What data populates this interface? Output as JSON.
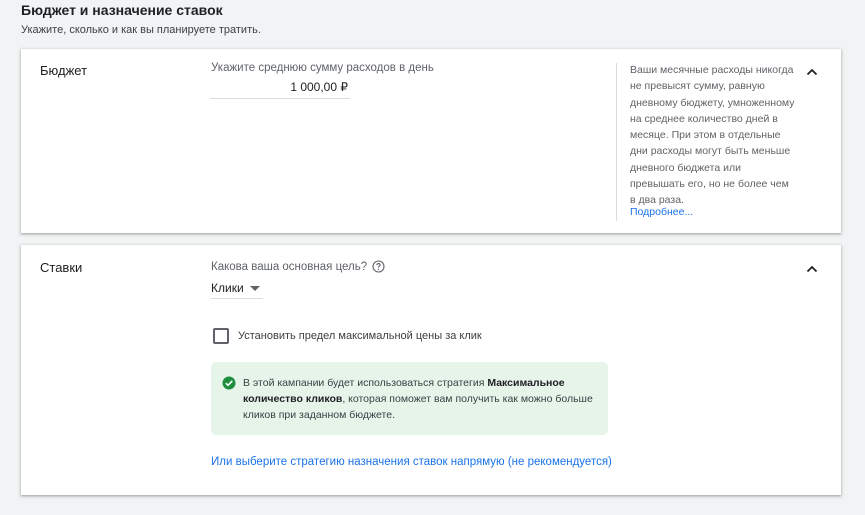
{
  "header": {
    "title": "Бюджет и назначение ставок",
    "subtitle": "Укажите, сколько и как вы планируете тратить."
  },
  "budget": {
    "label": "Бюджет",
    "hint": "Укажите среднюю сумму расходов в день",
    "amount": "1 000,00 ₽",
    "sidenote": "Ваши месячные расходы никогда не превысят сумму, равную дневному бюджету, умноженному на среднее количество дней в месяце. При этом в отдельные дни расходы могут быть меньше дневного бюджета или превышать его, но не более чем в два раза.",
    "more_link": "Подробнее...",
    "collapse_icon": "chevron-up-icon"
  },
  "bidding": {
    "label": "Ставки",
    "goal_question": "Какова ваша основная цель?",
    "goal_help_icon": "help-circle-icon",
    "goal_value": "Клики",
    "checkbox_label": "Установить предел максимальной цены за клик",
    "checkbox_checked": false,
    "info": {
      "icon": "check-circle-icon",
      "text_before": "В этой кампании будет использоваться стратегия ",
      "text_bold": "Максимальное количество кликов",
      "text_after": ", которая поможет вам получить как можно больше кликов при заданном бюджете."
    },
    "strategy_link": "Или выберите стратегию назначения ставок напрямую (не рекомендуется)",
    "collapse_icon": "chevron-up-icon"
  },
  "colors": {
    "accent": "#1a73e8",
    "success": "#1e8e3e",
    "info_bg": "#e6f4ea"
  }
}
